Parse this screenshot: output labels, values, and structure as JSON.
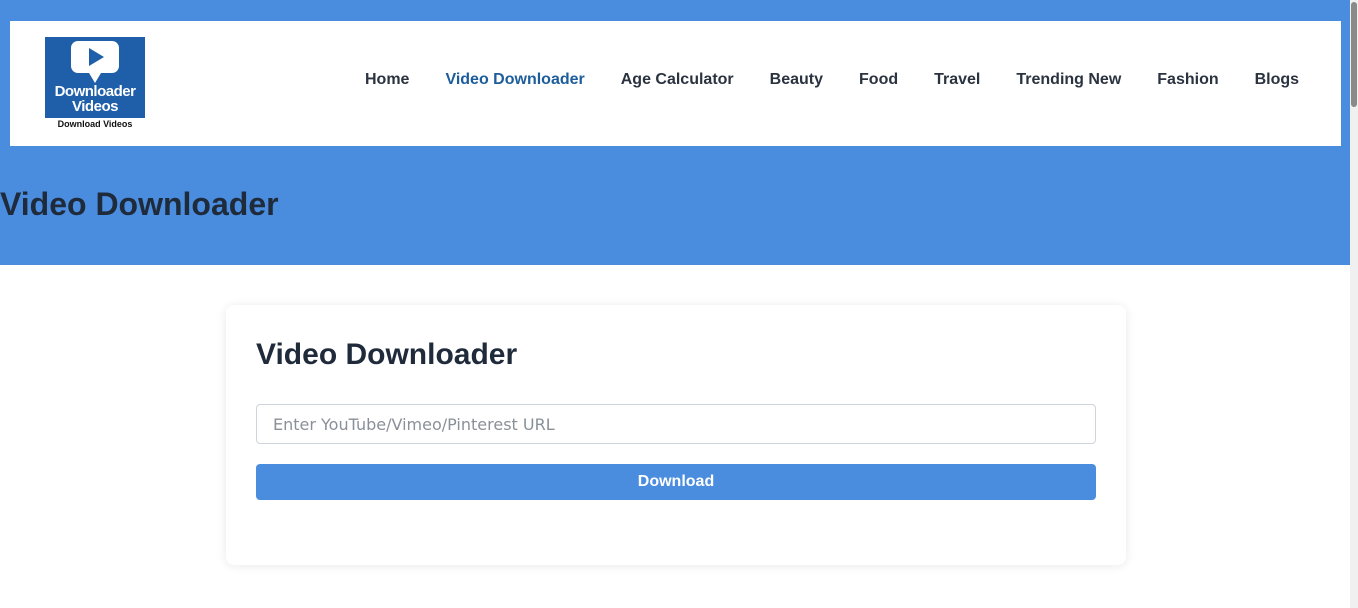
{
  "logo": {
    "title_line1": "Downloader",
    "title_line2": "Videos",
    "subtitle": "Download Videos"
  },
  "nav": {
    "items": [
      {
        "label": "Home"
      },
      {
        "label": "Video Downloader"
      },
      {
        "label": "Age Calculator"
      },
      {
        "label": "Beauty"
      },
      {
        "label": "Food"
      },
      {
        "label": "Travel"
      },
      {
        "label": "Trending New"
      },
      {
        "label": "Fashion"
      },
      {
        "label": "Blogs"
      }
    ],
    "active": "Video Downloader"
  },
  "page_title": "Video Downloader",
  "card": {
    "title": "Video Downloader",
    "url_input": {
      "value": "",
      "placeholder": "Enter YouTube/Vimeo/Pinterest URL"
    },
    "download_label": "Download"
  },
  "colors": {
    "band": "#4a8ddf",
    "active_nav": "#1d5d9b",
    "button": "#4a8ddf",
    "logo_bg": "#1f5ea8"
  },
  "icons": {
    "logo": "play-download-icon"
  }
}
